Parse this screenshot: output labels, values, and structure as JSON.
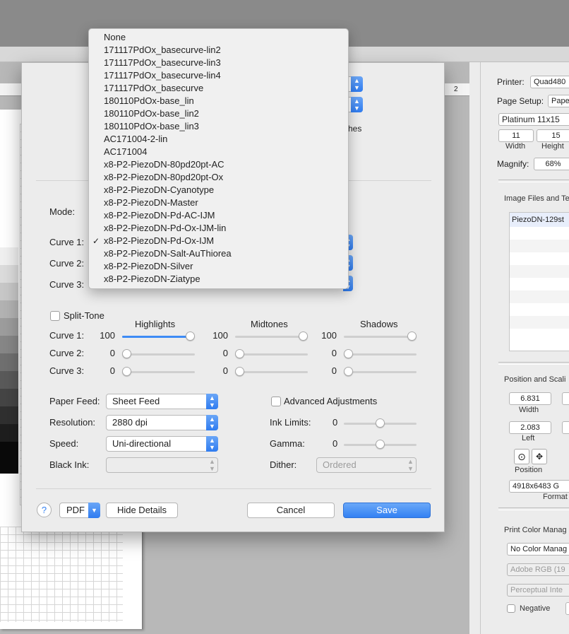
{
  "right_panel": {
    "printer_label": "Printer:",
    "printer_value": "Quad480",
    "page_setup_label": "Page Setup:",
    "page_setup_value": "Pape",
    "paper_size": "Platinum 11x15",
    "width_value": "11",
    "height_value": "15",
    "width_label": "Width",
    "height_label": "Height",
    "magnify_label": "Magnify:",
    "magnify_value": "68%",
    "image_files_label": "Image Files and Te",
    "image_file_item": "PiezoDN-129st",
    "position_scaling_label": "Position and Scali",
    "pos_width_value": "6.831",
    "pos_width_label": "Width",
    "pos_left_value": "2.083",
    "pos_left_label": "Left",
    "position_label": "Position",
    "format_value": "4918x6483 G",
    "format_label": "Format",
    "color_mgmt_label": "Print Color Manag",
    "color_mgmt_value": "No Color Manag",
    "profile_value": "Adobe RGB (19",
    "intent_value": "Perceptual Inte",
    "negative_label": "Negative"
  },
  "dialog": {
    "bg_partial_text": "hes",
    "mode_label": "Mode:",
    "curve1_label": "Curve 1:",
    "curve2_label": "Curve 2:",
    "curve3_label": "Curve 3:",
    "split_tone_label": "Split-Tone",
    "highlights_label": "Highlights",
    "midtones_label": "Midtones",
    "shadows_label": "Shadows",
    "st_curve1_label": "Curve 1:",
    "st_curve2_label": "Curve 2:",
    "st_curve3_label": "Curve 3:",
    "values": {
      "c1_high": "100",
      "c1_mid": "100",
      "c1_shadow": "100",
      "c2_high": "0",
      "c2_mid": "0",
      "c2_shadow": "0",
      "c3_high": "0",
      "c3_mid": "0",
      "c3_shadow": "0"
    },
    "levels": {
      "c1_high": 1.0,
      "c1_mid": 1.0,
      "c1_shadow": 1.0,
      "c2_high": 0.0,
      "c2_mid": 0.0,
      "c2_shadow": 0.0,
      "c3_high": 0.0,
      "c3_mid": 0.0,
      "c3_shadow": 0.0
    },
    "paper_feed_label": "Paper Feed:",
    "paper_feed_value": "Sheet Feed",
    "resolution_label": "Resolution:",
    "resolution_value": "2880 dpi",
    "speed_label": "Speed:",
    "speed_value": "Uni-directional",
    "black_ink_label": "Black Ink:",
    "black_ink_value": "",
    "advanced_label": "Advanced Adjustments",
    "ink_limits_label": "Ink Limits:",
    "ink_limits_value": "0",
    "gamma_label": "Gamma:",
    "gamma_value": "0",
    "dither_label": "Dither:",
    "dither_value": "Ordered",
    "help_label": "?",
    "pdf_label": "PDF",
    "hide_details_label": "Hide Details",
    "cancel_label": "Cancel",
    "save_label": "Save"
  },
  "menu": {
    "items": [
      "None",
      "171117PdOx_basecurve-lin2",
      "171117PdOx_basecurve-lin3",
      "171117PdOx_basecurve-lin4",
      "171117PdOx_basecurve",
      "180110PdOx-base_lin",
      "180110PdOx-base_lin2",
      "180110PdOx-base_lin3",
      "AC171004-2-lin",
      "AC171004",
      "x8-P2-PiezoDN-80pd20pt-AC",
      "x8-P2-PiezoDN-80pd20pt-Ox",
      "x8-P2-PiezoDN-Cyanotype",
      "x8-P2-PiezoDN-Master",
      "x8-P2-PiezoDN-Pd-AC-IJM",
      "x8-P2-PiezoDN-Pd-Ox-IJM-lin",
      "x8-P2-PiezoDN-Pd-Ox-IJM",
      "x8-P2-PiezoDN-Salt-AuThiorea",
      "x8-P2-PiezoDN-Silver",
      "x8-P2-PiezoDN-Ziatype"
    ],
    "checked_index": 16,
    "check_glyph": "✓"
  },
  "colors": {
    "accent": "#3381f3",
    "menu_bg": "#f0f0f0",
    "dialog_bg": "#ececec"
  },
  "ruler": {
    "mark": "2"
  }
}
